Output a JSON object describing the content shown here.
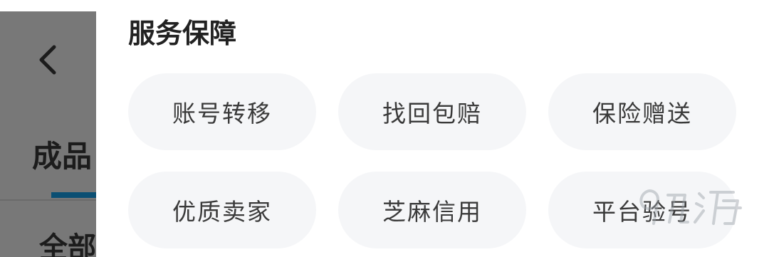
{
  "background_page": {
    "tab_label": "成品",
    "sub_label": "全部"
  },
  "drawer": {
    "section_title": "服务保障",
    "chips": [
      "账号转移",
      "找回包赔",
      "保险赠送",
      "优质卖家",
      "芝麻信用",
      "平台验号"
    ]
  },
  "watermark": {
    "text": "九游",
    "icon": "9game-logo"
  },
  "colors": {
    "overlay": "#787878",
    "chip_bg": "#f5f6f8",
    "chip_text": "#3a3a3a",
    "title_text": "#222222",
    "tab_indicator": "#0b4f73"
  }
}
